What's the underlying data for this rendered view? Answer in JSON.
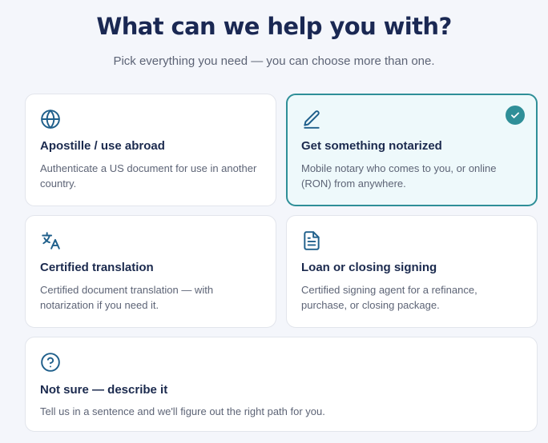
{
  "header": {
    "title": "What can we help you with?",
    "subtitle": "Pick everything you need — you can choose more than one."
  },
  "options": [
    {
      "title": "Apostille / use abroad",
      "description": "Authenticate a US document for use in another country.",
      "icon": "globe-icon",
      "selected": false
    },
    {
      "title": "Get something notarized",
      "description": "Mobile notary who comes to you, or online (RON) from anywhere.",
      "icon": "pen-icon",
      "selected": true
    },
    {
      "title": "Certified translation",
      "description": "Certified document translation — with notarization if you need it.",
      "icon": "translate-icon",
      "selected": false
    },
    {
      "title": "Loan or closing signing",
      "description": "Certified signing agent for a refinance, purchase, or closing package.",
      "icon": "document-icon",
      "selected": false
    },
    {
      "title": "Not sure — describe it",
      "description": "Tell us in a sentence and we'll figure out the right path for you.",
      "icon": "help-circle-icon",
      "selected": false
    }
  ],
  "colors": {
    "accent": "#2f8f98",
    "icon": "#1f5f8b",
    "heading": "#1a2853",
    "background": "#f4f6fb"
  }
}
